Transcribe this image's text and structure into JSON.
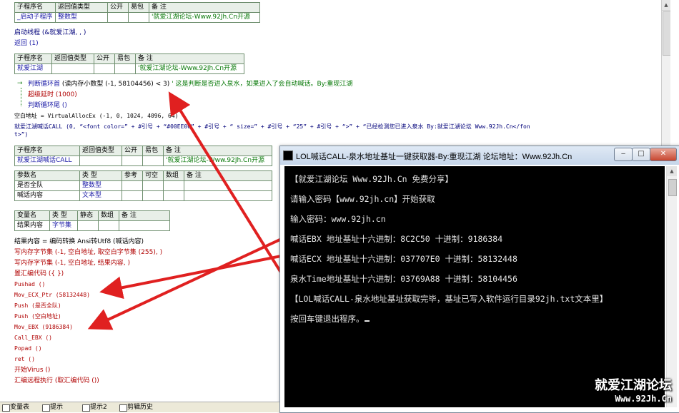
{
  "editor": {
    "table1": {
      "headers": [
        "子程序名",
        "返回值类型",
        "公开",
        "易包",
        "备 注"
      ],
      "row": [
        "_启动子程序",
        "整数型",
        "",
        "",
        "'就爱江湖论坛-Www.92Jh.Cn开源"
      ]
    },
    "line_start_thread": "启动线程 (&就爱江湖, , )",
    "line_return": "返回 (1)",
    "table2": {
      "headers": [
        "子程序名",
        "返回值类型",
        "公开",
        "易包",
        "备 注"
      ],
      "row": [
        "就爱江湖",
        "",
        "",
        "",
        "'就爱江湖论坛-Www.92Jh.Cn开源"
      ]
    },
    "loop_head_kw": "判断循环首",
    "loop_head_rest": "(读内存小数型 (-1, 58104456) < 3)",
    "loop_head_comment": "' 这是判断是否进入泉水，如果进入了会自动喊话。By:重现江湖",
    "loop_delay": "超级延时 (1000)",
    "loop_tail": "判断循环尾 ()",
    "alloc_line": "空白地址 = VirtualAllocEx (-1, 0, 1024, 4096, 64)",
    "shout_line1": "就爱江湖喊话CALL (0, “<font color=” + #引号 + “#00EE00” + #引号 + “ size=” + #引号 + “25” + #引号 + “>” + “已经检测您已进入泉水 By:就爱江湖论坛 Www.92Jh.Cn</fon",
    "shout_line2": "t>”)",
    "table3": {
      "headers": [
        "子程序名",
        "返回值类型",
        "公开",
        "易包",
        "备 注"
      ],
      "row": [
        "就爱江湖喊话CALL",
        "",
        "",
        "",
        "'就爱江湖论坛-Www.92Jh.Cn开源"
      ]
    },
    "table4": {
      "headers": [
        "参数名",
        "类 型",
        "参考",
        "可空",
        "数组",
        "备 注"
      ],
      "rows": [
        [
          "是否全队",
          "整数型",
          "",
          "",
          "",
          ""
        ],
        [
          "喊话内容",
          "文本型",
          "",
          "",
          "",
          ""
        ]
      ]
    },
    "table5": {
      "headers": [
        "变量名",
        "类 型",
        "静态",
        "数组",
        "备 注"
      ],
      "row": [
        "结果内容",
        "字节集",
        "",
        "",
        ""
      ]
    },
    "code_lines": [
      "结果内容 = 编码转换 Ansi转Utf8 (喊话内容)",
      "写内存字节集 (-1, 空白地址, 取空白字节集 (255), )",
      "写内存字节集 (-1, 空白地址, 结果内容, )",
      "置汇编代码 ({ })",
      "Pushad ()",
      "Mov_ECX_Ptr (58132448)",
      "Push (是否全队)",
      "Push (空白地址)",
      "Mov_EBX (9186384)",
      "Call_EBX ()",
      "Popad ()",
      "ret ()",
      "开始Virus ()",
      "汇编远程执行 (取汇编代码 ())"
    ]
  },
  "console": {
    "title": "LOL喊话CALL-泉水地址基址一键获取器-By:重现江湖 论坛地址：Www.92Jh.Cn",
    "minimize": "‒",
    "maximize": "□",
    "close": "✕",
    "lines": [
      "【就爱江湖论坛 Www.92Jh.Cn 免费分享】",
      "请输入密码【www.92jh.cn】开始获取",
      "输入密码：www.92jh.cn",
      "喊话EBX 地址基址十六进制：8C2C50      十进制：9186384",
      "喊话ECX 地址基址十六进制：037707E0    十进制：58132448",
      "泉水Time地址基址十六进制：03769A88    十进制：58104456",
      "【LOL喊话CALL-泉水地址基址获取完毕，基址已写入软件运行目录92jh.txt文本里】",
      "按回车键退出程序。"
    ]
  },
  "watermark": {
    "line1": "就爱江湖论坛",
    "line2": "Www.92Jh.Cn"
  },
  "tabs": [
    "变量表",
    "提示",
    "提示2",
    "剪辑历史"
  ],
  "colors": {
    "arrow": "#e02020",
    "console_bg": "#000000",
    "console_text": "#e6e6e6"
  }
}
